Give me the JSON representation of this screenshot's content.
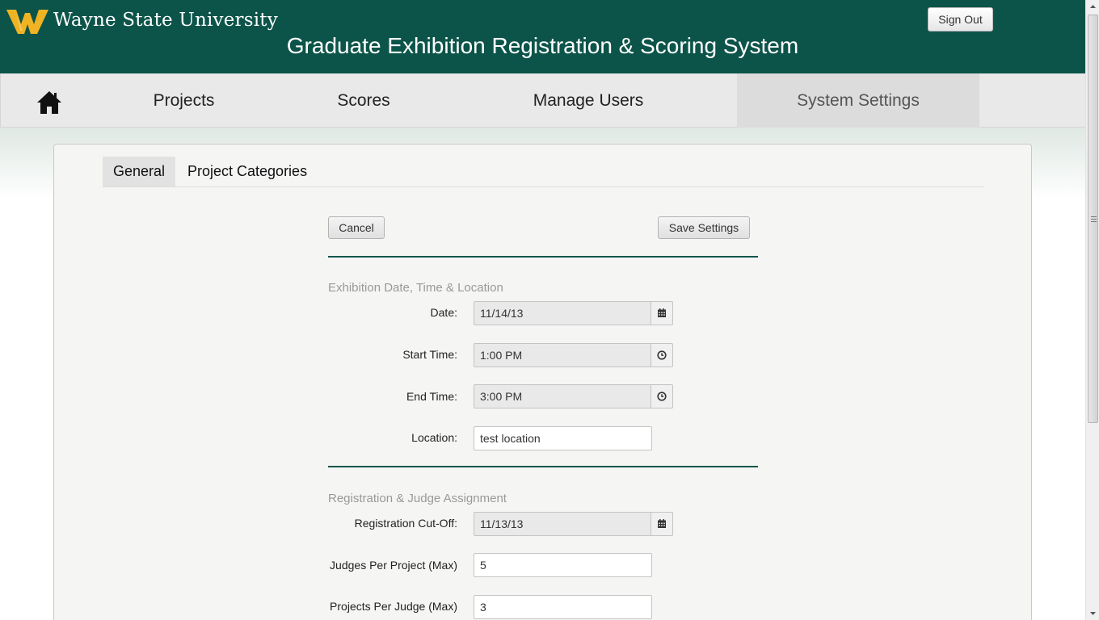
{
  "header": {
    "university": "Wayne State University",
    "app_title": "Graduate Exhibition Registration & Scoring System",
    "sign_out": "Sign Out",
    "brand_color": "#0c5449",
    "logo_color": "#f0b323"
  },
  "nav": {
    "home_icon": "home-icon",
    "items": [
      {
        "label": "Projects"
      },
      {
        "label": "Scores"
      },
      {
        "label": "Manage Users"
      },
      {
        "label": "System Settings",
        "active": true
      }
    ]
  },
  "tabs": [
    {
      "label": "General",
      "active": true
    },
    {
      "label": "Project Categories"
    }
  ],
  "actions": {
    "cancel": "Cancel",
    "save": "Save Settings"
  },
  "sections": {
    "exhibition": {
      "title": "Exhibition Date, Time & Location",
      "date_label": "Date:",
      "date_value": "11/14/13",
      "start_label": "Start Time:",
      "start_value": "1:00 PM",
      "end_label": "End Time:",
      "end_value": "3:00 PM",
      "location_label": "Location:",
      "location_value": "test location"
    },
    "registration": {
      "title": "Registration & Judge Assignment",
      "cutoff_label": "Registration Cut-Off:",
      "cutoff_value": "11/13/13",
      "judges_label": "Judges Per Project (Max)",
      "judges_value": "5",
      "projects_label": "Projects Per Judge (Max)",
      "projects_value": "3"
    }
  }
}
